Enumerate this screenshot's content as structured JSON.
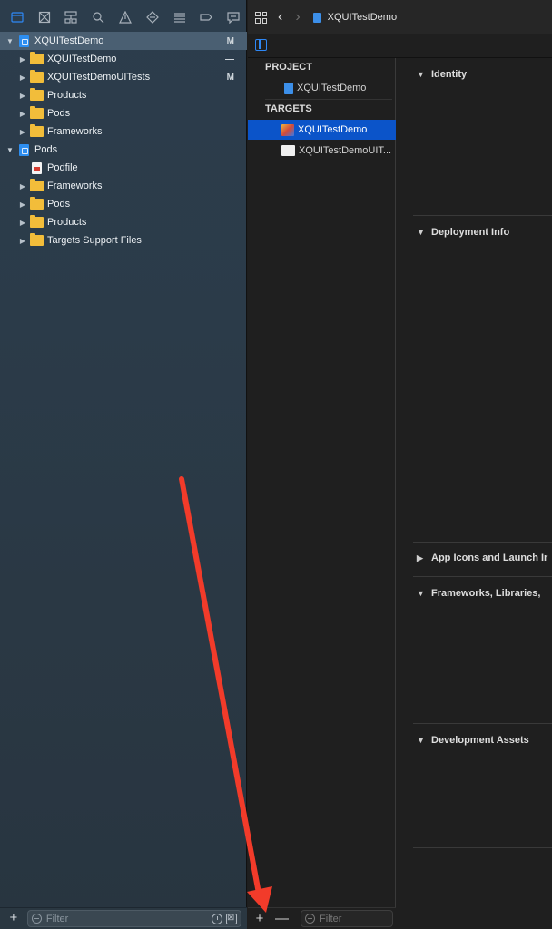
{
  "navigator": {
    "toolbar_icons": [
      "folder-icon",
      "source-control-icon",
      "hierarchy-icon",
      "search-icon",
      "warning-icon",
      "test-icon",
      "debug-icon",
      "breakpoint-icon",
      "report-icon"
    ],
    "tree": [
      {
        "label": "XQUITestDemo",
        "badge": "M",
        "icon": "xcodeproj-icon",
        "expanded": true
      },
      {
        "label": "XQUITestDemo",
        "badge": "—",
        "icon": "folder-icon",
        "expanded": false
      },
      {
        "label": "XQUITestDemoUITests",
        "badge": "M",
        "icon": "folder-icon",
        "expanded": false
      },
      {
        "label": "Products",
        "badge": "",
        "icon": "folder-icon",
        "expanded": false
      },
      {
        "label": "Pods",
        "badge": "",
        "icon": "folder-icon",
        "expanded": false
      },
      {
        "label": "Frameworks",
        "badge": "",
        "icon": "folder-icon",
        "expanded": false
      },
      {
        "label": "Pods",
        "badge": "",
        "icon": "xcodeproj-icon",
        "expanded": true
      },
      {
        "label": "Podfile",
        "badge": "",
        "icon": "podfile-icon",
        "expanded": null
      },
      {
        "label": "Frameworks",
        "badge": "",
        "icon": "folder-icon",
        "expanded": false
      },
      {
        "label": "Pods",
        "badge": "",
        "icon": "folder-icon",
        "expanded": false
      },
      {
        "label": "Products",
        "badge": "",
        "icon": "folder-icon",
        "expanded": false
      },
      {
        "label": "Targets Support Files",
        "badge": "",
        "icon": "folder-icon",
        "expanded": false
      }
    ],
    "filter_placeholder": "Filter"
  },
  "jumpbar": {
    "crumb": "XQUITestDemo"
  },
  "targets_panel": {
    "project_header": "PROJECT",
    "project_item": "XQUITestDemo",
    "targets_header": "TARGETS",
    "target_items": [
      "XQUITestDemo",
      "XQUITestDemoUIT..."
    ],
    "filter_placeholder": "Filter",
    "add_label": "+",
    "remove_label": "—"
  },
  "settings": {
    "sections": [
      {
        "label": "Identity",
        "expanded": true
      },
      {
        "label": "Deployment Info",
        "expanded": true
      },
      {
        "label": "App Icons and Launch Ir",
        "expanded": false
      },
      {
        "label": "Frameworks, Libraries,",
        "expanded": true
      },
      {
        "label": "Development Assets",
        "expanded": true
      }
    ]
  },
  "colors": {
    "accent": "#2e88f6",
    "selection": "#0b54c9",
    "annotation_arrow": "#f23b2a"
  }
}
